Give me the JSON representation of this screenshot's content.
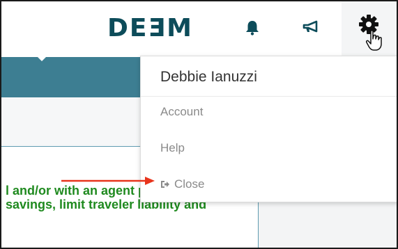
{
  "header": {
    "logo_text": "DEƎM",
    "icons": [
      "bell-icon",
      "megaphone-icon",
      "gear-icon"
    ]
  },
  "user_menu": {
    "user_name": "Debbie Ianuzzi",
    "items": [
      {
        "label": "Account"
      },
      {
        "label": "Help"
      },
      {
        "label": "Close",
        "icon": "sign-out-icon"
      }
    ]
  },
  "content": {
    "line1": "l and/or with an agent per company",
    "line2": "savings, limit traveler liability and"
  },
  "colors": {
    "brand": "#0d4c5a",
    "teal_band": "#3d7e92",
    "green_text": "#1f8a1f",
    "annotation_arrow": "#e8341c"
  }
}
